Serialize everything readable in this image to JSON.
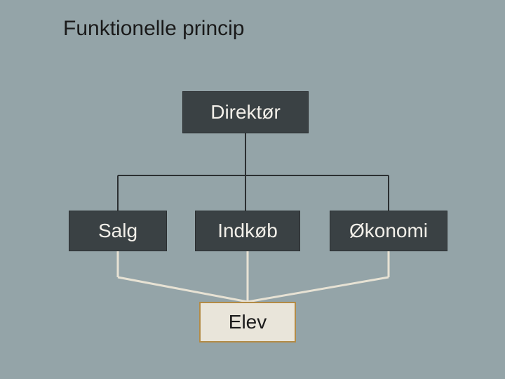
{
  "title": "Funktionelle princip",
  "nodes": {
    "director": "Direktør",
    "sales": "Salg",
    "purchasing": "Indkøb",
    "economy": "Økonomi",
    "trainee": "Elev"
  },
  "colors": {
    "bg": "#94a4a8",
    "box_dark": "#3a4144",
    "box_text_light": "#f2efe9",
    "box_light": "#e9e5da",
    "box_light_border": "#b38b46",
    "line_dark": "#2b2f31",
    "line_connector_light": "#e7e2d4"
  }
}
